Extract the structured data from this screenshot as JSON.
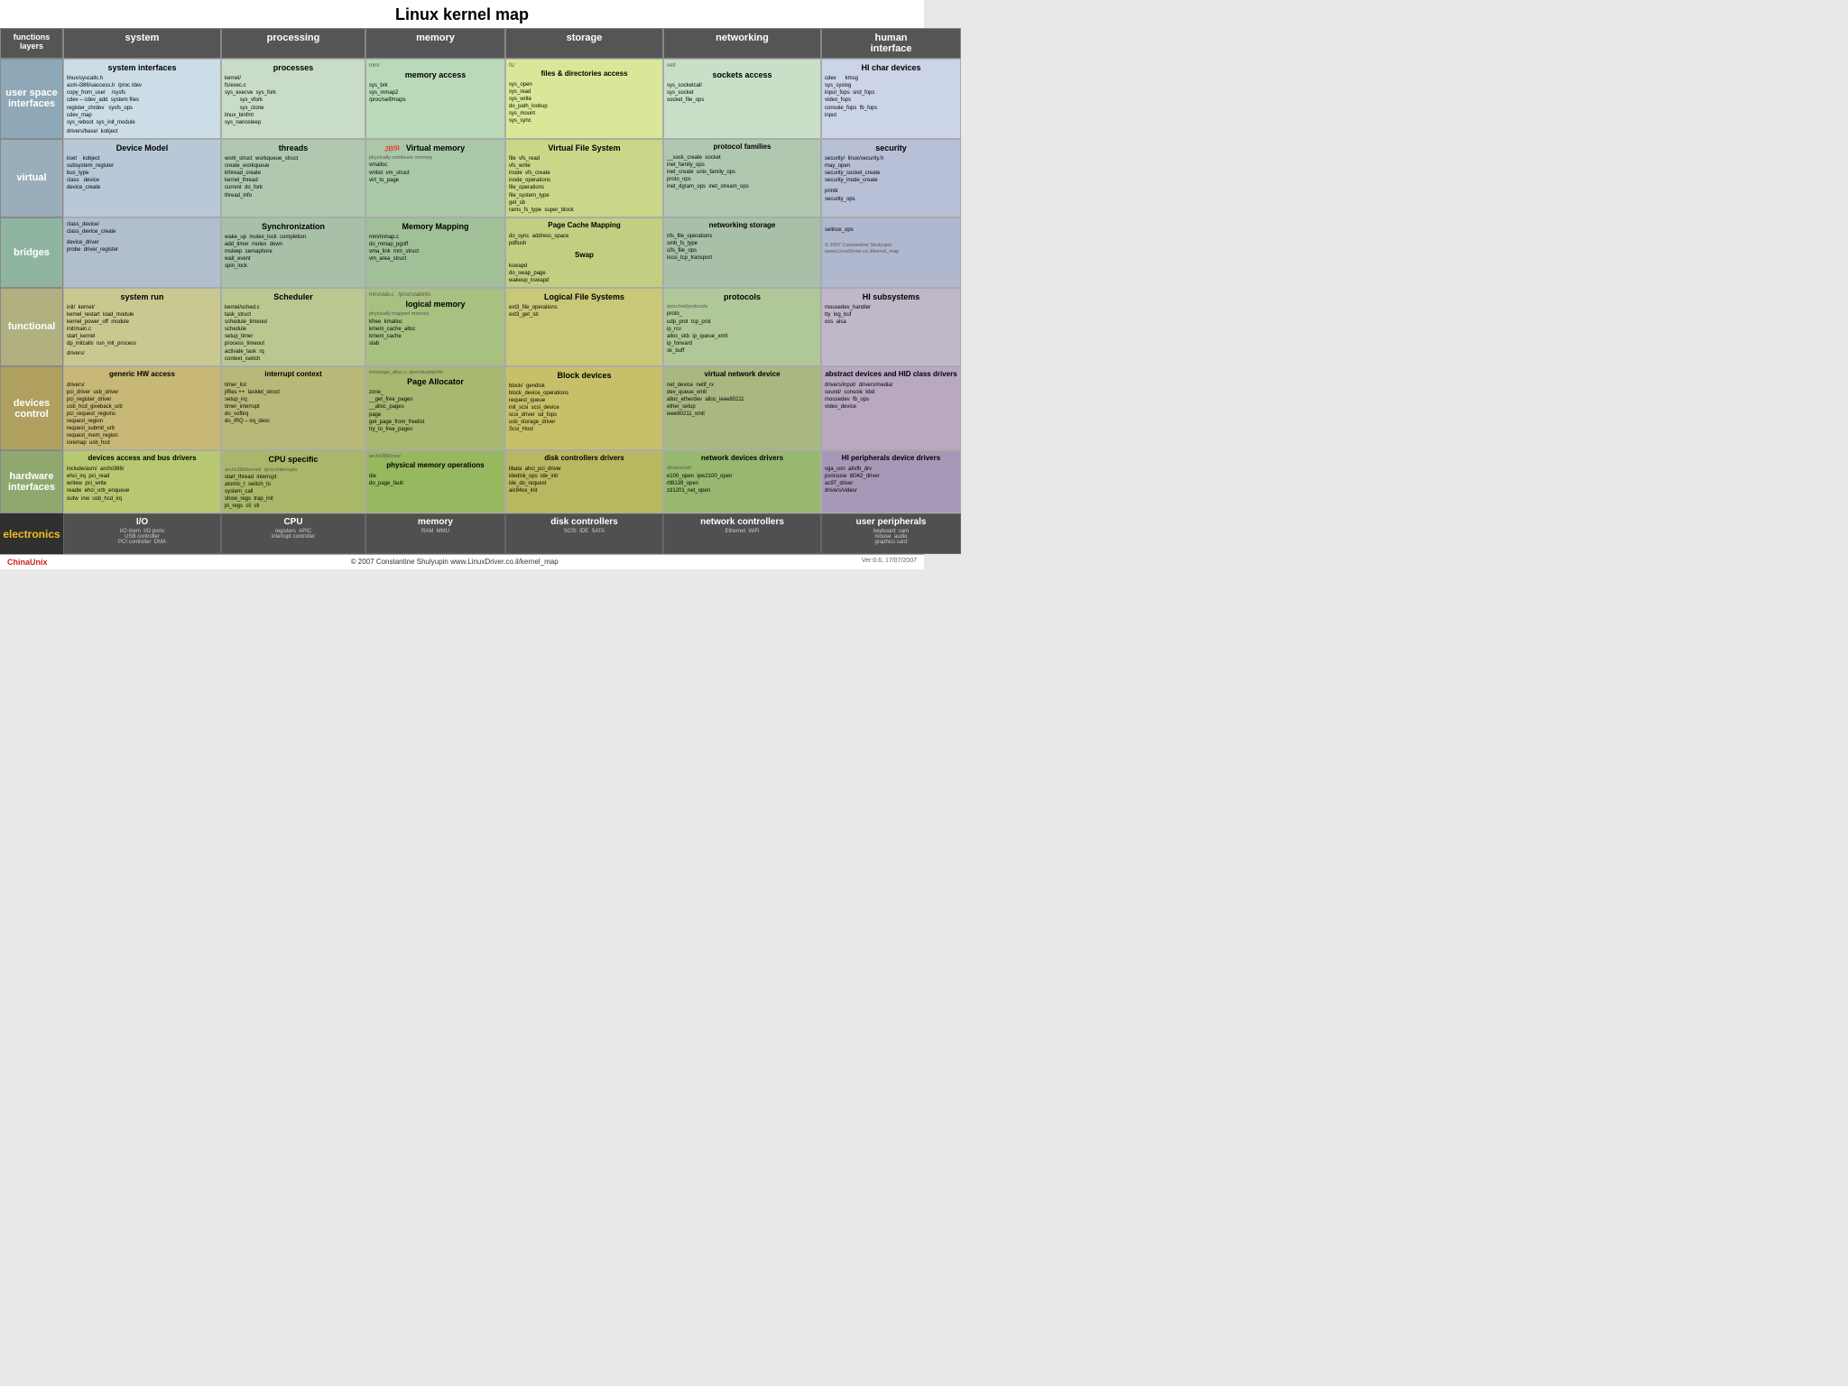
{
  "title": "Linux kernel map",
  "columns": {
    "layers": "functions\nlayers",
    "system": "system",
    "processing": "processing",
    "memory": "memory",
    "storage": "storage",
    "networking": "networking",
    "hi": "human\ninterface"
  },
  "rows": {
    "userspace": {
      "label": "user space\ninterfaces",
      "system": {
        "title": "system interfaces",
        "items": [
          "linux/syscalls.h",
          "asm-i386/uaccess.h",
          "/proc /dev",
          "copy_from_user",
          "/sysfs",
          "cdev – cdev_add",
          "register_chrdev",
          "sysfs_ops",
          "cdev_map",
          "sys_reboot",
          "sys_init_module"
        ]
      },
      "processing": {
        "title": "processes",
        "items": [
          "kernel/",
          "fs/exec.c",
          "sys_execve",
          "sys_fork",
          "sys_vfork",
          "sys_clone",
          "linux_binfmt",
          "sys_nanosleep"
        ]
      },
      "memory": {
        "title": "memory access",
        "subtitle": "mm/",
        "items": [
          "sys_brk",
          "sys_mmap2",
          "/proc/self/maps"
        ]
      },
      "storage": {
        "title": "files & directories access",
        "subtitle": "fs/",
        "items": [
          "sys_open",
          "sys_read",
          "sys_write",
          "do_path_lookup",
          "sys_mount",
          "sys_sync"
        ]
      },
      "networking": {
        "title": "sockets access",
        "subtitle": "net/",
        "items": [
          "sys_socketcall",
          "sys_socket",
          "socket_file_ops"
        ]
      },
      "hi": {
        "title": "HI char devices",
        "items": [
          "cdev",
          "kmsg",
          "sys_syslog",
          "input_fops",
          "snd_fops",
          "video_fops",
          "console_fops",
          "fb_fops",
          "input"
        ]
      }
    },
    "virtual": {
      "label": "virtual",
      "system": {
        "title": "Device Model",
        "items": [
          "kset",
          "kobject",
          "subsystem_register",
          "bus_type",
          "class",
          "device",
          "device_create"
        ]
      },
      "processing": {
        "title": "threads",
        "items": [
          "work_struct",
          "workqueue_struct",
          "create_workqueue",
          "kthread_create",
          "kernel_thread",
          "current",
          "do_fork",
          "thread_info"
        ]
      },
      "memory": {
        "title": "Virtual memory",
        "subtitle": "physically continues memory",
        "items": [
          "vmalloc",
          "vmlist",
          "vm_struct",
          "virt_to_page"
        ]
      },
      "storage": {
        "title": "Virtual File System",
        "items": [
          "file",
          "vfs_read",
          "vfs_write",
          "inode",
          "vfs_create",
          "inode_operations",
          "file_operations",
          "file_system_type",
          "get_sb",
          "rams_fs_type",
          "super_block"
        ]
      },
      "networking": {
        "title": "protocol families",
        "items": [
          "__sock_create",
          "socket",
          "inet_family_ops",
          "inet_create",
          "unix_family_ops",
          "proto_ops",
          "inet_dgram_ops",
          "inet_stream_ops"
        ]
      },
      "hi": {
        "title": "security",
        "items": [
          "security/",
          "linux/security.h",
          "may_open",
          "security_socket_create",
          "security_inode_create",
          "printk",
          "security_ops"
        ]
      }
    },
    "bridges": {
      "label": "bridges",
      "system": {
        "items": [
          "class_device/",
          "class_device_create",
          "device_driver",
          "probe",
          "driver_register"
        ]
      },
      "processing": {
        "title": "Synchronization",
        "items": [
          "wake_up",
          "mutex_lock",
          "completion",
          "add_timer",
          "mutex",
          "down",
          "msleep",
          "semaphore",
          "wait_event",
          "spin_lock"
        ]
      },
      "memory": {
        "title": "Memory Mapping",
        "items": [
          "mm/mmap.c",
          "do_mmap_pgoff",
          "vma_link",
          "mm_struct",
          "vm_area_struct"
        ]
      },
      "storage": {
        "title": "Page Cache Mapping",
        "items": [
          "do_sync",
          "address_space",
          "pdflush"
        ],
        "subtitle2": "Swap",
        "items2": [
          "kswapd",
          "do_swap_page",
          "wakeup_kswapd"
        ]
      },
      "networking": {
        "title": "networking storage",
        "items": [
          "nfs_file_operations",
          "smb_fs_type",
          "cifs_file_ops",
          "iscsi_tcp_transport"
        ]
      },
      "hi": {
        "items": [
          "selinux_ops",
          "© 2007 Constantine Shulyupin",
          "www.LinuxDriver.co.il/kernel_map"
        ]
      }
    },
    "functional": {
      "label": "functional",
      "system": {
        "title": "system run",
        "items": [
          "init/",
          "kernel/",
          "kernel_restart",
          "load_module",
          "kernel_power_off",
          "module",
          "init/main.c",
          "start_kernel",
          "dp_initcalls",
          "run_init_process",
          "drivers/"
        ]
      },
      "processing": {
        "title": "Scheduler",
        "items": [
          "kernel/sched.c",
          "task_struct",
          "schedule_timeout",
          "schedule",
          "setup_timer",
          "process_timeout",
          "activate_task",
          "rq",
          "context_switch"
        ]
      },
      "memory": {
        "title": "logical memory",
        "subtitle": "physically mapped memory",
        "items": [
          "mm/slab.c",
          "/proc/slabinfo",
          "kfree",
          "kmalloc",
          "kmem_cache_alloc",
          "kmem_cache",
          "slab"
        ]
      },
      "storage": {
        "title": "Logical\nFile Systems",
        "items": [
          "ext3_file_operations",
          "ext3_get_sb"
        ]
      },
      "networking": {
        "title": "protocols",
        "subtitle": "/proc/net/protocols",
        "items": [
          "proto_",
          "udp_prot",
          "tcp_prot",
          "ip_rcv",
          "alloc_skb",
          "ip_queue_xmit",
          "ip_forward",
          "sk_buff"
        ]
      },
      "hi": {
        "title": "HI subsystems",
        "items": [
          "mousedev_handler",
          "tty",
          "log_buf",
          "oss",
          "alsa"
        ]
      }
    },
    "devices": {
      "label": "devices\ncontrol",
      "system": {
        "title": "generic HW access",
        "items": [
          "drivers/",
          "pci_driver",
          "usb_driver",
          "pci_register_driver",
          "usb_hcd_giveback_urb",
          "pci_request_regions",
          "request_region",
          "request_submit_urb",
          "request_mem_region",
          "ioremap",
          "usb_hcd"
        ]
      },
      "processing": {
        "title": "interrupt context",
        "items": [
          "timer_list",
          "jiffies ++",
          "tasklet_struct",
          "setup_irq",
          "timer_interrupt",
          "do_softirq",
          "do_IRQ",
          "irq_desc"
        ]
      },
      "memory": {
        "title": "Page Allocator",
        "subtitle": "mm/page_alloc.c /proc/buddyinfo",
        "items": [
          "zone_",
          "__get_free_pages",
          "__alloc_pages",
          "page",
          "get_page_from_freelist",
          "try_to_free_pages"
        ]
      },
      "storage": {
        "title": "Block devices",
        "items": [
          "block/",
          "gendisk",
          "block_device_operations",
          "request_queue",
          "init_scsi",
          "scsi_device",
          "scsi_driver",
          "sd_fops",
          "usb_storage_driver",
          "Scsi_Host"
        ]
      },
      "networking": {
        "title": "virtual\nnetwork device",
        "items": [
          "net_device",
          "netif_rx",
          "dev_queue_xmit",
          "alloc_etherdev",
          "alloc_ieee80211",
          "ether_setup",
          "ieee80211_xmit"
        ]
      },
      "hi": {
        "title": "abstract devices\nand\nHID class drivers",
        "items": [
          "drivers/input/",
          "drivers/media/",
          "sound/",
          "console",
          "kbd",
          "mousedev",
          "fb_ops",
          "video_device"
        ]
      }
    },
    "hardware": {
      "label": "hardware\ninterfaces",
      "system": {
        "title": "devices access\nand bus drivers",
        "items": [
          "include/asm/",
          "arch/i386/",
          "ehci_irq",
          "pci_read",
          "writew",
          "pci_write",
          "readw",
          "ehci_urb_enqueue",
          "outw",
          "inw",
          "usb_hcd_irq"
        ]
      },
      "processing": {
        "title": "CPU specific",
        "subtitle": "/proc/interrupts",
        "items": [
          "arch/i386/kernel/",
          "start_thread",
          "atomic_t",
          "interrupt",
          "switch_to",
          "system_call",
          "show_regs",
          "trap_init",
          "pt_regs",
          "cli",
          "sti"
        ]
      },
      "memory": {
        "title": "physical memory\noperations",
        "subtitle": "arch/i386/mm/",
        "items": [
          "die",
          "do_page_fault"
        ]
      },
      "storage": {
        "title": "disk\ncontrollers drivers",
        "items": [
          "libata",
          "ahci_pci_driver",
          "idedisk_ops",
          "ide_intr",
          "ide_do_request",
          "aic94xx_init"
        ]
      },
      "networking": {
        "title": "network\ndevices drivers",
        "subtitle": "drivers/net/",
        "items": [
          "e100_open",
          "ipw2100_open",
          "rtl8139_open",
          "zd1201_net_open"
        ]
      },
      "hi": {
        "title": "HI peripherals\ndevice drivers",
        "items": [
          "vga_con",
          "atixfb_drv",
          "psmouse",
          "i8042_driver",
          "ac97_driver",
          "drivers/video/"
        ]
      }
    }
  },
  "electronics": {
    "label": "electronics",
    "io": {
      "title": "I/O",
      "items": [
        "I/O mem",
        "I/O ports",
        "USB\ncontroller",
        "PCI\ncontroller\nDMA"
      ]
    },
    "cpu": {
      "title": "CPU",
      "items": [
        "registers",
        "APIC",
        "interrupt\ncontroller"
      ]
    },
    "memory": {
      "title": "memory",
      "items": [
        "RAM",
        "MMU"
      ]
    },
    "disk": {
      "title": "disk controllers",
      "items": [
        "SCSI",
        "IDE",
        "SATA"
      ]
    },
    "network": {
      "title": "network controllers",
      "items": [
        "Ethernet",
        "WiFi"
      ]
    },
    "peripherals": {
      "title": "user peripherals",
      "items": [
        "keyboard",
        "cam",
        "mouse",
        "audio",
        "graphics card"
      ]
    }
  },
  "footer": {
    "left": "ChinaUnix",
    "center": "© 2007 Constantine Shulyupin www.LinuxDriver.co.il/kernel_map",
    "right": "Ver:0.6, 17/07/2007"
  }
}
